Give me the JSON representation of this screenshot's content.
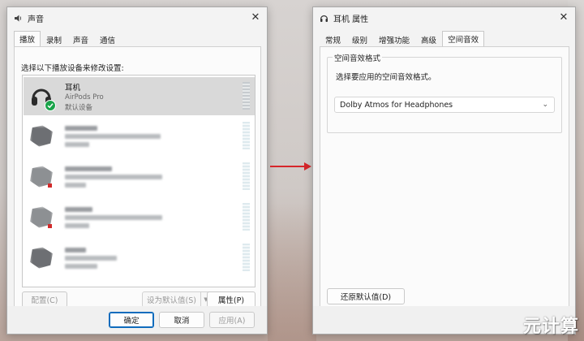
{
  "sound_window": {
    "title": "声音",
    "tabs": [
      {
        "label": "播放",
        "active": true
      },
      {
        "label": "录制",
        "active": false
      },
      {
        "label": "声音",
        "active": false
      },
      {
        "label": "通信",
        "active": false
      }
    ],
    "instruction": "选择以下播放设备来修改设置:",
    "devices": [
      {
        "name": "耳机",
        "model": "AirPods Pro",
        "status": "默认设备",
        "selected": true,
        "icon": "headphones-icon",
        "badge": "default-check-icon"
      },
      {
        "blurred": true,
        "icon": "speaker-icon"
      },
      {
        "blurred": true,
        "icon": "speaker-icon"
      },
      {
        "blurred": true,
        "icon": "speaker-icon"
      },
      {
        "blurred": true,
        "icon": "headset-icon"
      }
    ],
    "buttons": {
      "configure": "配置(C)",
      "set_default": "设为默认值(S)",
      "properties": "属性(P)",
      "ok": "确定",
      "cancel": "取消",
      "apply": "应用(A)"
    }
  },
  "properties_window": {
    "title": "耳机 属性",
    "tabs": [
      {
        "label": "常规",
        "active": false
      },
      {
        "label": "级别",
        "active": false
      },
      {
        "label": "增强功能",
        "active": false
      },
      {
        "label": "高级",
        "active": false
      },
      {
        "label": "空间音效",
        "active": true
      }
    ],
    "group_label": "空间音效格式",
    "description": "选择要应用的空间音效格式。",
    "format_selected": "Dolby Atmos for Headphones",
    "restore_button": "还原默认值(D)"
  },
  "watermark": "元计算",
  "colors": {
    "accent_arrow": "#d6262a",
    "default_badge": "#1aa34a",
    "selection": "#d9d9d9",
    "primary_border": "#0f6cbd"
  }
}
